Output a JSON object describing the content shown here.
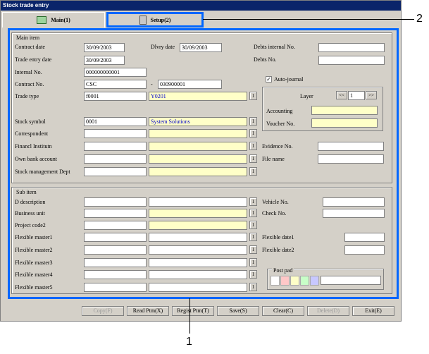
{
  "window": {
    "title": "Stock trade entry"
  },
  "tabs": [
    {
      "label": "Main(1)"
    },
    {
      "label": "Setup(2)"
    }
  ],
  "callouts": {
    "one": "1",
    "two": "2"
  },
  "main_item": {
    "title": "Main item",
    "contract_date": {
      "label": "Contract date",
      "value": "30/09/2003"
    },
    "dlvry_date": {
      "label": "Dlvry date",
      "value": "30/09/2003"
    },
    "debts_internal_no": {
      "label": "Debts internal No.",
      "value": ""
    },
    "trade_entry_date": {
      "label": "Trade entry date",
      "value": "30/09/2003"
    },
    "debts_no": {
      "label": "Debts No.",
      "value": ""
    },
    "internal_no": {
      "label": "Internal No.",
      "value": "000000000001"
    },
    "auto_journal": {
      "label": "Auto-journal",
      "checked": "✓"
    },
    "contract_no": {
      "label": "Contract No.",
      "value1": "CSC",
      "sep": "-",
      "value2": "030900001"
    },
    "trade_type": {
      "label": "Trade type",
      "code": "f0001",
      "name": "Y0201"
    },
    "layer": {
      "label": "Layer",
      "prev": "<<",
      "value": "1",
      "next": ">>"
    },
    "accounting": {
      "label": "Accounting",
      "value": ""
    },
    "voucher_no": {
      "label": "Voucher No.",
      "value": ""
    },
    "stock_symbol": {
      "label": "Stock symbol",
      "code": "0001",
      "name": "System Solutions"
    },
    "correspondent": {
      "label": "Correspondent"
    },
    "financl_institutn": {
      "label": "Financl Institutn"
    },
    "evidence_no": {
      "label": "Evidence No."
    },
    "own_bank_account": {
      "label": "Own bank account"
    },
    "file_name": {
      "label": "File name"
    },
    "stock_mgmt_dept": {
      "label": "Stock management Dept"
    }
  },
  "sub_item": {
    "title": "Sub item",
    "d_description": {
      "label": "D description"
    },
    "vehicle_no": {
      "label": "Vehicle No."
    },
    "business_unit": {
      "label": "Business unit"
    },
    "check_no": {
      "label": "Check No."
    },
    "project_code2": {
      "label": "Project code2"
    },
    "flexible_master1": {
      "label": "Flexible master1"
    },
    "flexible_date1": {
      "label": "Flexible date1"
    },
    "flexible_master2": {
      "label": "Flexible master2"
    },
    "flexible_date2": {
      "label": "Flexible date2"
    },
    "flexible_master3": {
      "label": "Flexible master3"
    },
    "flexible_master4": {
      "label": "Flexible master4"
    },
    "flexible_master5": {
      "label": "Flexible master5"
    },
    "post_pad": {
      "label": "Post pad",
      "colors": [
        "#ffffff",
        "#ffc8c8",
        "#ffffc8",
        "#c8ffc8",
        "#c8c8ff"
      ]
    }
  },
  "lookup_button": "1",
  "buttons": {
    "copy": "Copy(F)",
    "read_ptm": "Read Ptm(X)",
    "regist_ptm": "Regist Ptm(T)",
    "save": "Save(S)",
    "clear": "Clear(C)",
    "delete": "Delete(D)",
    "exit": "Exit(E)"
  }
}
